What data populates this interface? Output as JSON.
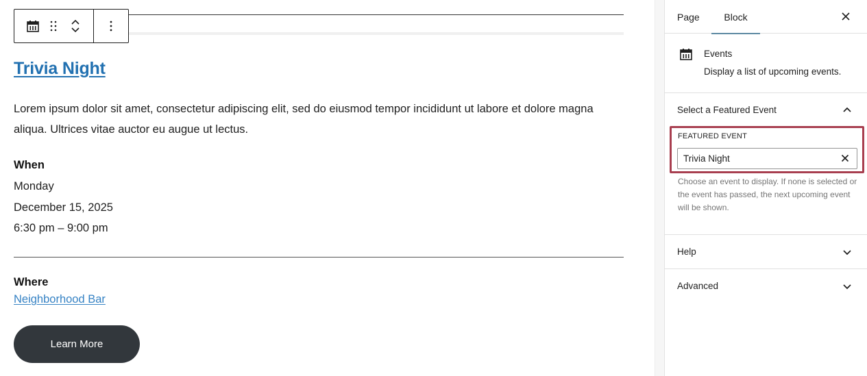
{
  "editor": {
    "toolbar": {
      "block_icon": "calendar-icon",
      "drag_icon": "drag-handle-icon",
      "move_up_icon": "chevron-up-icon",
      "move_down_icon": "chevron-down-icon",
      "options_icon": "more-vertical-icon"
    },
    "event": {
      "title": "Trivia Night",
      "description": "Lorem ipsum dolor sit amet, consectetur adipiscing elit, sed do eiusmod tempor incididunt ut labore et dolore magna aliqua. Ultrices vitae auctor eu augue ut lectus.",
      "when_label": "When",
      "day": "Monday",
      "date": "December 15, 2025",
      "time": "6:30 pm – 9:00 pm",
      "where_label": "Where",
      "venue": "Neighborhood Bar",
      "button_label": "Learn More"
    }
  },
  "sidebar": {
    "tabs": [
      {
        "label": "Page",
        "active": false
      },
      {
        "label": "Block",
        "active": true
      }
    ],
    "close_icon": "close-icon",
    "block": {
      "icon": "calendar-icon",
      "name": "Events",
      "description": "Display a list of upcoming events."
    },
    "panels": [
      {
        "title": "Select a Featured Event",
        "expanded": true,
        "field_label": "FEATURED EVENT",
        "field_value": "Trivia Night",
        "help": "Choose an event to display. If none is selected or the event has passed, the next upcoming event will be shown."
      },
      {
        "title": "Help",
        "expanded": false
      },
      {
        "title": "Advanced",
        "expanded": false
      }
    ],
    "highlight_color": "#a83e4f",
    "accent_color": "#2271b1"
  }
}
